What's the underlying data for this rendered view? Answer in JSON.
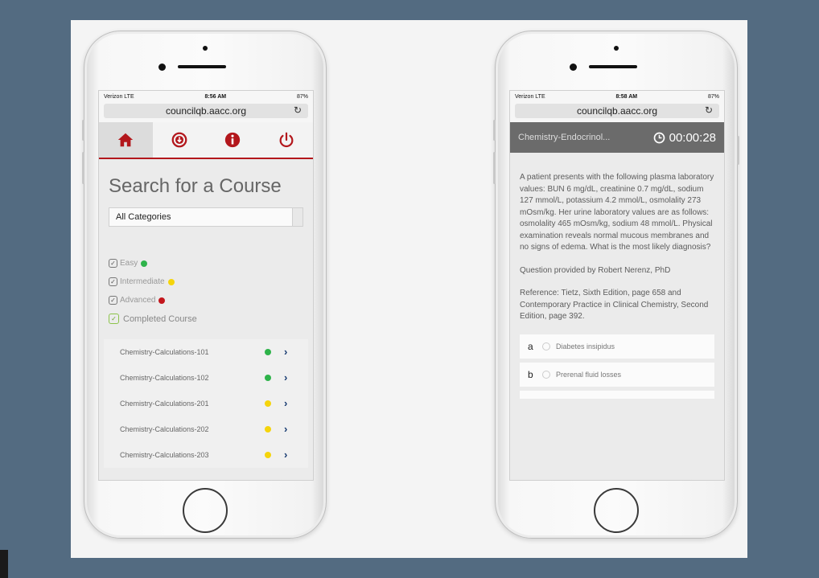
{
  "left_phone": {
    "status": {
      "carrier": "Verizon LTE",
      "time": "8:56 AM",
      "battery": "87%"
    },
    "url": "councilqb.aacc.org",
    "nav": [
      {
        "icon": "home-icon",
        "active": true
      },
      {
        "icon": "download-icon",
        "active": false
      },
      {
        "icon": "info-icon",
        "active": false
      },
      {
        "icon": "power-icon",
        "active": false
      }
    ],
    "title": "Search for a Course",
    "category_select": "All Categories",
    "filters": [
      {
        "label": "Easy",
        "color": "#2eb34a"
      },
      {
        "label": "Intermediate",
        "color": "#f5d40b"
      },
      {
        "label": "Advanced",
        "color": "#c3161c"
      }
    ],
    "completed_label": "Completed Course",
    "courses": [
      {
        "name": "Chemistry-Calculations-101",
        "color": "#2eb34a"
      },
      {
        "name": "Chemistry-Calculations-102",
        "color": "#2eb34a"
      },
      {
        "name": "Chemistry-Calculations-201",
        "color": "#f5d40b"
      },
      {
        "name": "Chemistry-Calculations-202",
        "color": "#f5d40b"
      },
      {
        "name": "Chemistry-Calculations-203",
        "color": "#f5d40b"
      }
    ]
  },
  "right_phone": {
    "status": {
      "carrier": "Verizon LTE",
      "time": "8:58 AM",
      "battery": "87%"
    },
    "url": "councilqb.aacc.org",
    "topic": "Chemistry-Endocrinol...",
    "timer": "00:00:28",
    "question": "A patient presents with the following plasma laboratory values: BUN 6 mg/dL, creatinine 0.7 mg/dL, sodium 127 mmol/L, potassium 4.2 mmol/L, osmolality 273 mOsm/kg. Her urine laboratory values are as follows: osmolality 465 mOsm/kg, sodium 48 mmol/L. Physical examination reveals normal mucous membranes and no signs of edema. What is the most likely diagnosis?",
    "provided_by": "Question provided by Robert Nerenz, PhD",
    "reference": "Reference: Tietz, Sixth Edition, page 658 and Contemporary Practice in Clinical Chemistry, Second Edition, page 392.",
    "answers": [
      {
        "letter": "a",
        "text": "Diabetes insipidus"
      },
      {
        "letter": "b",
        "text": "Prerenal fluid losses"
      }
    ]
  },
  "colors": {
    "brand_red": "#b3171c",
    "chevron": "#163a70",
    "header_gray": "#6b6b6b"
  }
}
